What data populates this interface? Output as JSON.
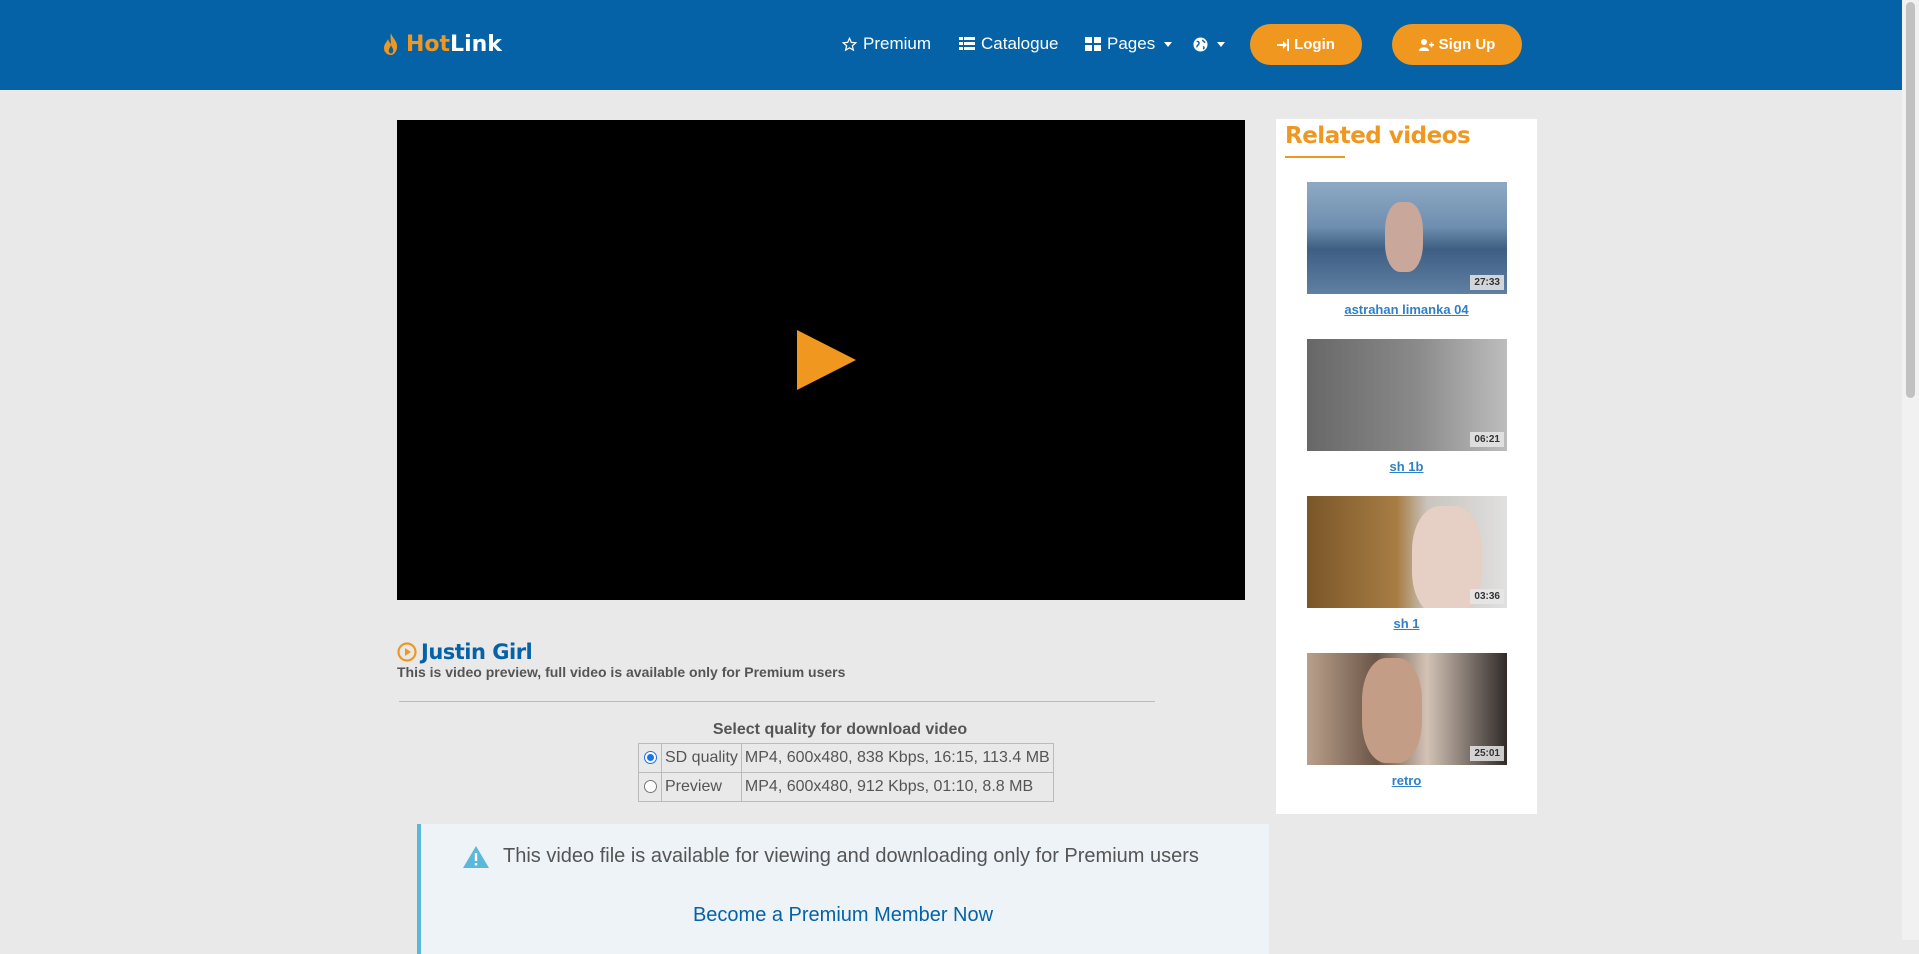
{
  "brand": {
    "hot": "Hot",
    "link": "Link"
  },
  "nav": {
    "premium": "Premium",
    "catalogue": "Catalogue",
    "pages": "Pages",
    "login": "Login",
    "signup": "Sign Up"
  },
  "video": {
    "title": "Justin Girl",
    "subtitle": "This is video preview, full video is available only for Premium users"
  },
  "quality": {
    "heading": "Select quality for download video",
    "options": [
      {
        "label": "SD quality",
        "info": "MP4, 600x480, 838 Kbps, 16:15, 113.4 MB",
        "selected": true
      },
      {
        "label": "Preview",
        "info": "MP4, 600x480, 912 Kbps, 01:10, 8.8 MB",
        "selected": false
      }
    ]
  },
  "notice": {
    "text": "This video file is available for viewing and downloading only for Premium users",
    "link": "Become a Premium Member Now"
  },
  "related": {
    "title": "Related videos",
    "items": [
      {
        "title": "astrahan limanka 04",
        "duration": "27:33"
      },
      {
        "title": "sh 1b",
        "duration": "06:21"
      },
      {
        "title": "sh 1",
        "duration": "03:36"
      },
      {
        "title": "retro",
        "duration": "25:01"
      }
    ]
  },
  "colors": {
    "navbar": "#0562a6",
    "accent": "#f0971f",
    "notice_border": "#5bb8db"
  }
}
